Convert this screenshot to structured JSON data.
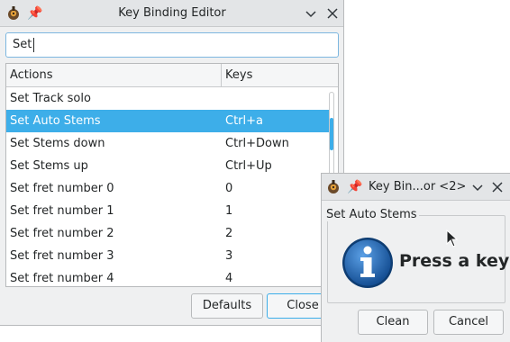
{
  "main_window": {
    "title": "Key Binding Editor",
    "search_value": "Set",
    "columns": [
      "Actions",
      "Keys"
    ],
    "rows": [
      {
        "action": "Set Track solo",
        "keys": ""
      },
      {
        "action": "Set Auto Stems",
        "keys": "Ctrl+a",
        "selected": true
      },
      {
        "action": "Set Stems down",
        "keys": "Ctrl+Down"
      },
      {
        "action": "Set Stems up",
        "keys": "Ctrl+Up"
      },
      {
        "action": "Set fret number 0",
        "keys": "0"
      },
      {
        "action": "Set fret number 1",
        "keys": "1"
      },
      {
        "action": "Set fret number 2",
        "keys": "2"
      },
      {
        "action": "Set fret number 3",
        "keys": "3"
      },
      {
        "action": "Set fret number 4",
        "keys": "4"
      }
    ],
    "defaults_label": "Defaults",
    "close_label": "Close"
  },
  "dialog": {
    "title": "Key Bin...or <2>",
    "group_title": "Set Auto Stems",
    "prompt": "Press a key",
    "clean_label": "Clean",
    "cancel_label": "Cancel"
  },
  "colors": {
    "selection": "#3daee9",
    "window_bg": "#eff0f1",
    "info_blue": "#1d5fa8"
  },
  "icons": [
    "app-icon",
    "pin-icon",
    "chevron-down-icon",
    "close-icon",
    "info-icon",
    "mouse-cursor-icon"
  ]
}
